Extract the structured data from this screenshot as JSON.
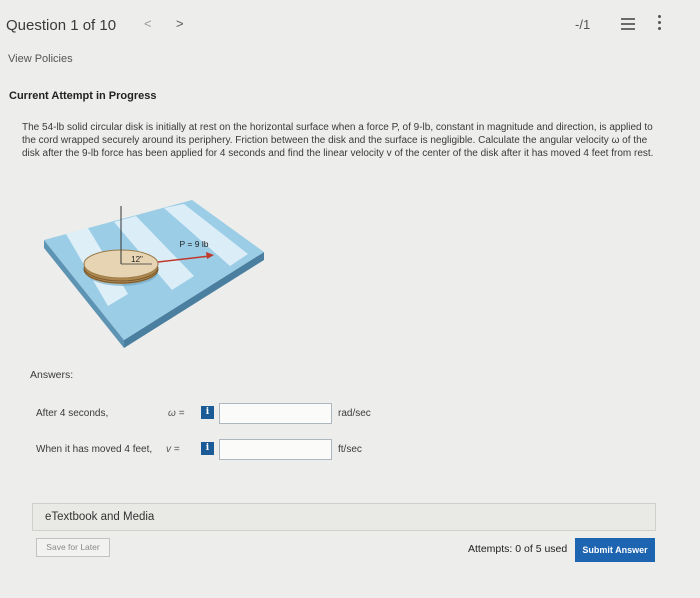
{
  "header": {
    "question_title": "Question 1 of 10",
    "prev_glyph": "<",
    "next_glyph": ">",
    "score": "-/1",
    "list_icon": "list-icon",
    "more_icon": "more-vertical-icon"
  },
  "view_policies": "View Policies",
  "attempt_heading": "Current Attempt in Progress",
  "problem_text": "The 54-lb solid circular disk is initially at rest on the horizontal surface when a force P, of 9-lb, constant in magnitude and direction, is applied to the cord wrapped securely around its periphery. Friction between the disk and the surface is negligible. Calculate the angular velocity ω of the disk after the 9-lb force has been applied for 4 seconds and find the linear velocity v of the center of the disk after it has moved 4 feet from rest.",
  "figure": {
    "radius_label": "12\"",
    "force_label": "P = 9 lb"
  },
  "answers_label": "Answers:",
  "answers": [
    {
      "label": "After 4 seconds,",
      "symbol": "ω =",
      "info": "i",
      "value": "",
      "unit": "rad/sec"
    },
    {
      "label": "When it has moved 4 feet,",
      "symbol": "v =",
      "info": "i",
      "value": "",
      "unit": "ft/sec"
    }
  ],
  "etextbook_label": "eTextbook and Media",
  "save_label": "Save for Later",
  "attempts_text": "Attempts: 0 of 5 used",
  "submit_label": "Submit Answer",
  "colors": {
    "submit_bg": "#1d64b1",
    "info_bg": "#1a5a96",
    "surface_blue": "#8fc6e3"
  }
}
